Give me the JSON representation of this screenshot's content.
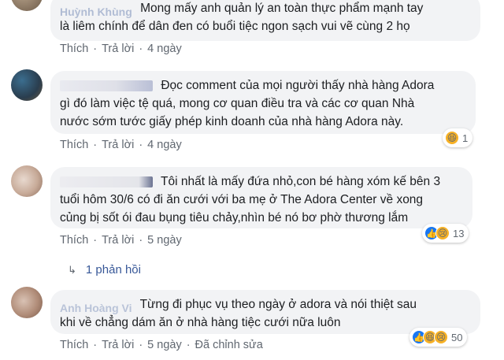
{
  "comments": [
    {
      "author": "Huỳnh Khùng",
      "text_line1": "Mong mấy anh quản lý an toàn thực phẩm mạnh tay",
      "text_line2": "là liêm chính để dân đen có buổi tiệc ngon sạch vui vẽ cùng 2 họ",
      "like": "Thích",
      "reply": "Trả lời",
      "time": "4 ngày"
    },
    {
      "text_line1": "Đọc comment của mọi người thấy nhà hàng Adora",
      "text_line2": "gì đó làm việc tệ quá, mong cơ quan điều tra và các cơ quan Nhà",
      "text_line3": "nước sớm tước giấy phép kinh doanh của nhà hàng Adora này.",
      "like": "Thích",
      "reply": "Trả lời",
      "time": "4 ngày",
      "reaction_count": "1"
    },
    {
      "text_line1": "Tôi nhất là mấy đứa nhỏ,con bé hàng xóm kế bên 3",
      "text_line2": "tuổi hôm 30/6 có đi ăn cưới với ba mẹ ở The Adora Center về xong",
      "text_line3": "củng bị sốt ói đau bụng tiêu chảy,nhìn bé nó bơ phờ thương lắm",
      "like": "Thích",
      "reply": "Trả lời",
      "time": "5 ngày",
      "reaction_count": "13",
      "replies_label": "1 phản hồi"
    },
    {
      "author": "Anh Hoàng Vi",
      "text_line1": "Từng đi phục vụ theo ngày ở adora và nói thiệt sau",
      "text_line2": "khi về chẳng dám ăn ở nhà hàng tiệc cưới nữa luôn",
      "like": "Thích",
      "reply": "Trả lời",
      "time": "5 ngày",
      "edited": "Đã chỉnh sửa",
      "reaction_count": "50"
    }
  ],
  "separator": "·",
  "icons": {
    "like": "thumbs-up-icon",
    "haha": "haha-emoji-icon",
    "sad": "sad-emoji-icon",
    "reply_arrow": "reply-arrow-icon"
  },
  "colors": {
    "bubble": "#f2f3f5",
    "meta": "#606770",
    "link": "#385898",
    "like_blue": "#1877f2",
    "emoji_yellow": "#f7b125"
  }
}
